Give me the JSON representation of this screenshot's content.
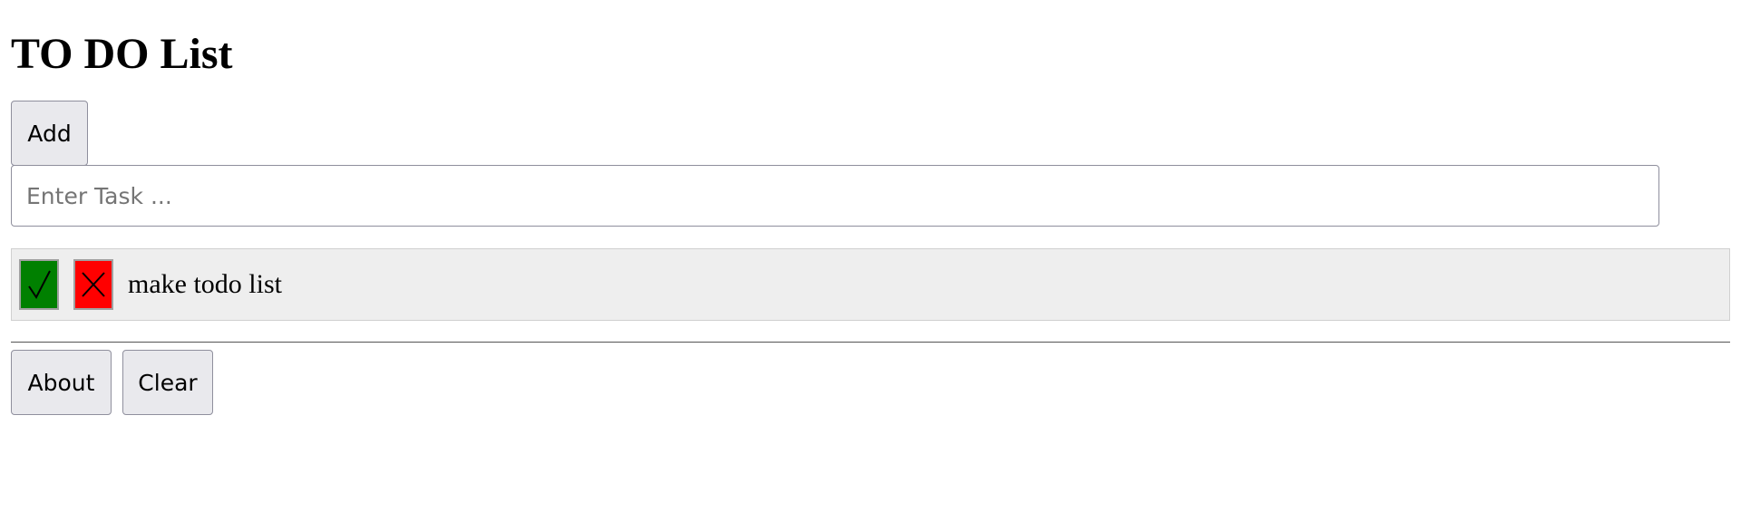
{
  "header": {
    "title": "TO DO List"
  },
  "controls": {
    "add_label": "Add",
    "task_input": {
      "value": "",
      "placeholder": "Enter Task ..."
    }
  },
  "todos": [
    {
      "text": "make todo list",
      "done_icon": "check-icon",
      "delete_icon": "x-icon",
      "done_color": "#008000",
      "delete_color": "#ff0000"
    }
  ],
  "footer": {
    "about_label": "About",
    "clear_label": "Clear"
  }
}
